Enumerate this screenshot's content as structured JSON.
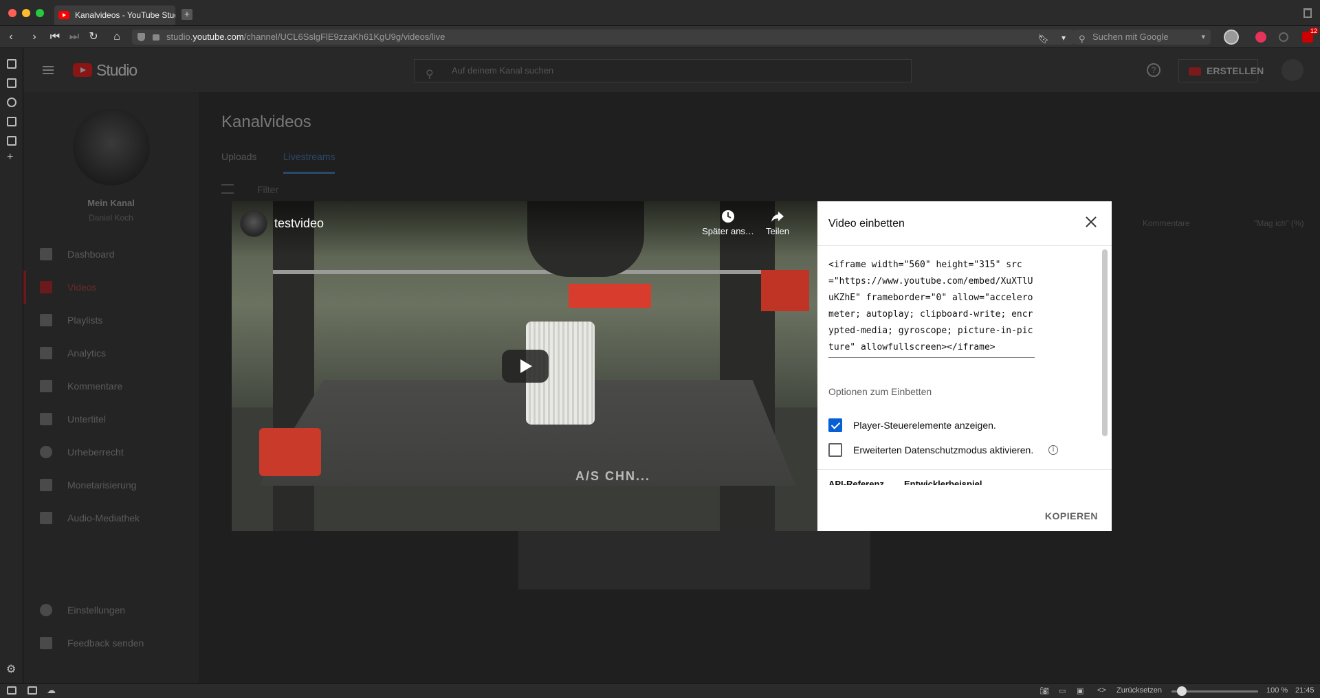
{
  "browser": {
    "tab_title": "Kanalvideos - YouTube Studio",
    "new_tab": "+",
    "url_prefix": "studio.",
    "url_host": "youtube.com",
    "url_path": "/channel/UCL6SslgFlE9zzaKh61KgU9g/videos/live",
    "search_placeholder": "Suchen mit Google",
    "extension_badge": "12"
  },
  "statusbar": {
    "reset_label": "Zurücksetzen",
    "zoom": "100 %",
    "clock": "21:45",
    "zoom_level": 0.12
  },
  "header": {
    "studio_label": "Studio",
    "search_placeholder": "Auf deinem Kanal suchen",
    "help": "?",
    "create_label": "ERSTELLEN"
  },
  "sidebar": {
    "channel_name": "Mein Kanal",
    "channel_owner": "Daniel Koch",
    "items": [
      {
        "label": "Dashboard"
      },
      {
        "label": "Videos"
      },
      {
        "label": "Playlists"
      },
      {
        "label": "Analytics"
      },
      {
        "label": "Kommentare"
      },
      {
        "label": "Untertitel"
      },
      {
        "label": "Urheberrecht"
      },
      {
        "label": "Monetarisierung"
      },
      {
        "label": "Audio-Mediathek"
      }
    ],
    "settings_label": "Einstellungen",
    "feedback_label": "Feedback senden"
  },
  "content": {
    "title": "Kanalvideos",
    "tabs": [
      {
        "label": "Uploads"
      },
      {
        "label": "Livestreams"
      }
    ],
    "filter_label": "Filter",
    "col_comments": "Kommentare",
    "col_likes": "\"Mag ich\" (%)"
  },
  "player": {
    "video_title": "testvideo",
    "watch_later": "Später ans…",
    "share": "Teilen",
    "overlay_text": "A/S CHN..."
  },
  "embed": {
    "title": "Video einbetten",
    "code": "<iframe width=\"560\" height=\"315\" src=\"https://www.youtube.com/embed/XuXTlUuKZhE\" frameborder=\"0\" allow=\"accelerometer; autoplay; clipboard-write; encrypted-media; gyroscope; picture-in-picture\" allowfullscreen></iframe>",
    "options_title": "Optionen zum Einbetten",
    "option_controls": "Player-Steuerelemente anzeigen.",
    "option_controls_checked": true,
    "option_privacy": "Erweiterten Datenschutzmodus aktivieren.",
    "option_privacy_checked": false,
    "info": "i",
    "link_api": "API-Referenz",
    "link_dev": "Entwicklerbeispiel",
    "copy_label": "KOPIEREN"
  }
}
